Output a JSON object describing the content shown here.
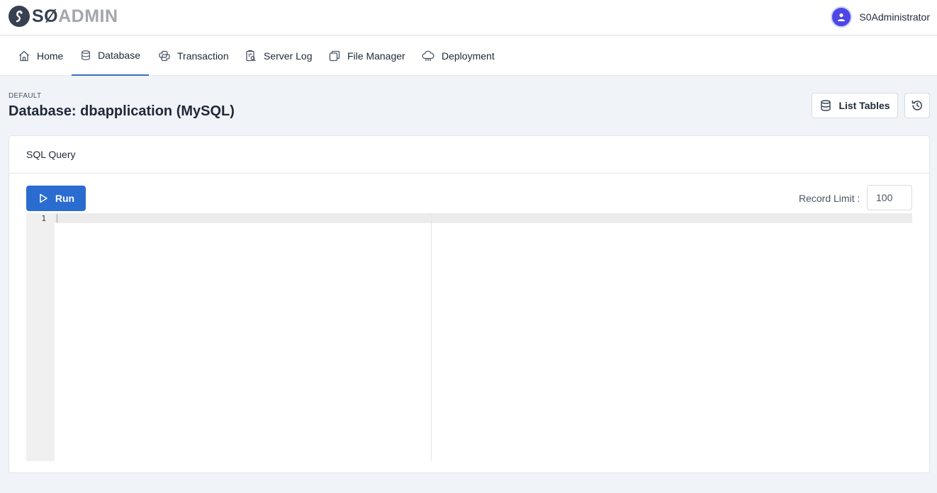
{
  "logo": {
    "text_dark": "SØ",
    "text_light": "ADMIN"
  },
  "user": {
    "name": "S0Administrator"
  },
  "nav": [
    {
      "label": "Home",
      "icon": "home-icon"
    },
    {
      "label": "Database",
      "icon": "database-icon",
      "active": true
    },
    {
      "label": "Transaction",
      "icon": "transaction-icon"
    },
    {
      "label": "Server Log",
      "icon": "server-log-icon"
    },
    {
      "label": "File Manager",
      "icon": "file-manager-icon"
    },
    {
      "label": "Deployment",
      "icon": "cloud-icon"
    }
  ],
  "page": {
    "breadcrumb": "DEFAULT",
    "title": "Database: dbapplication (MySQL)",
    "list_tables_label": "List Tables"
  },
  "query": {
    "card_title": "SQL Query",
    "run_label": "Run",
    "record_limit_label": "Record Limit :",
    "record_limit_value": "100",
    "line_number": "1"
  },
  "colors": {
    "primary": "#2a6ccf",
    "nav_active": "#3b6fb6",
    "avatar": "#4f46e5"
  }
}
